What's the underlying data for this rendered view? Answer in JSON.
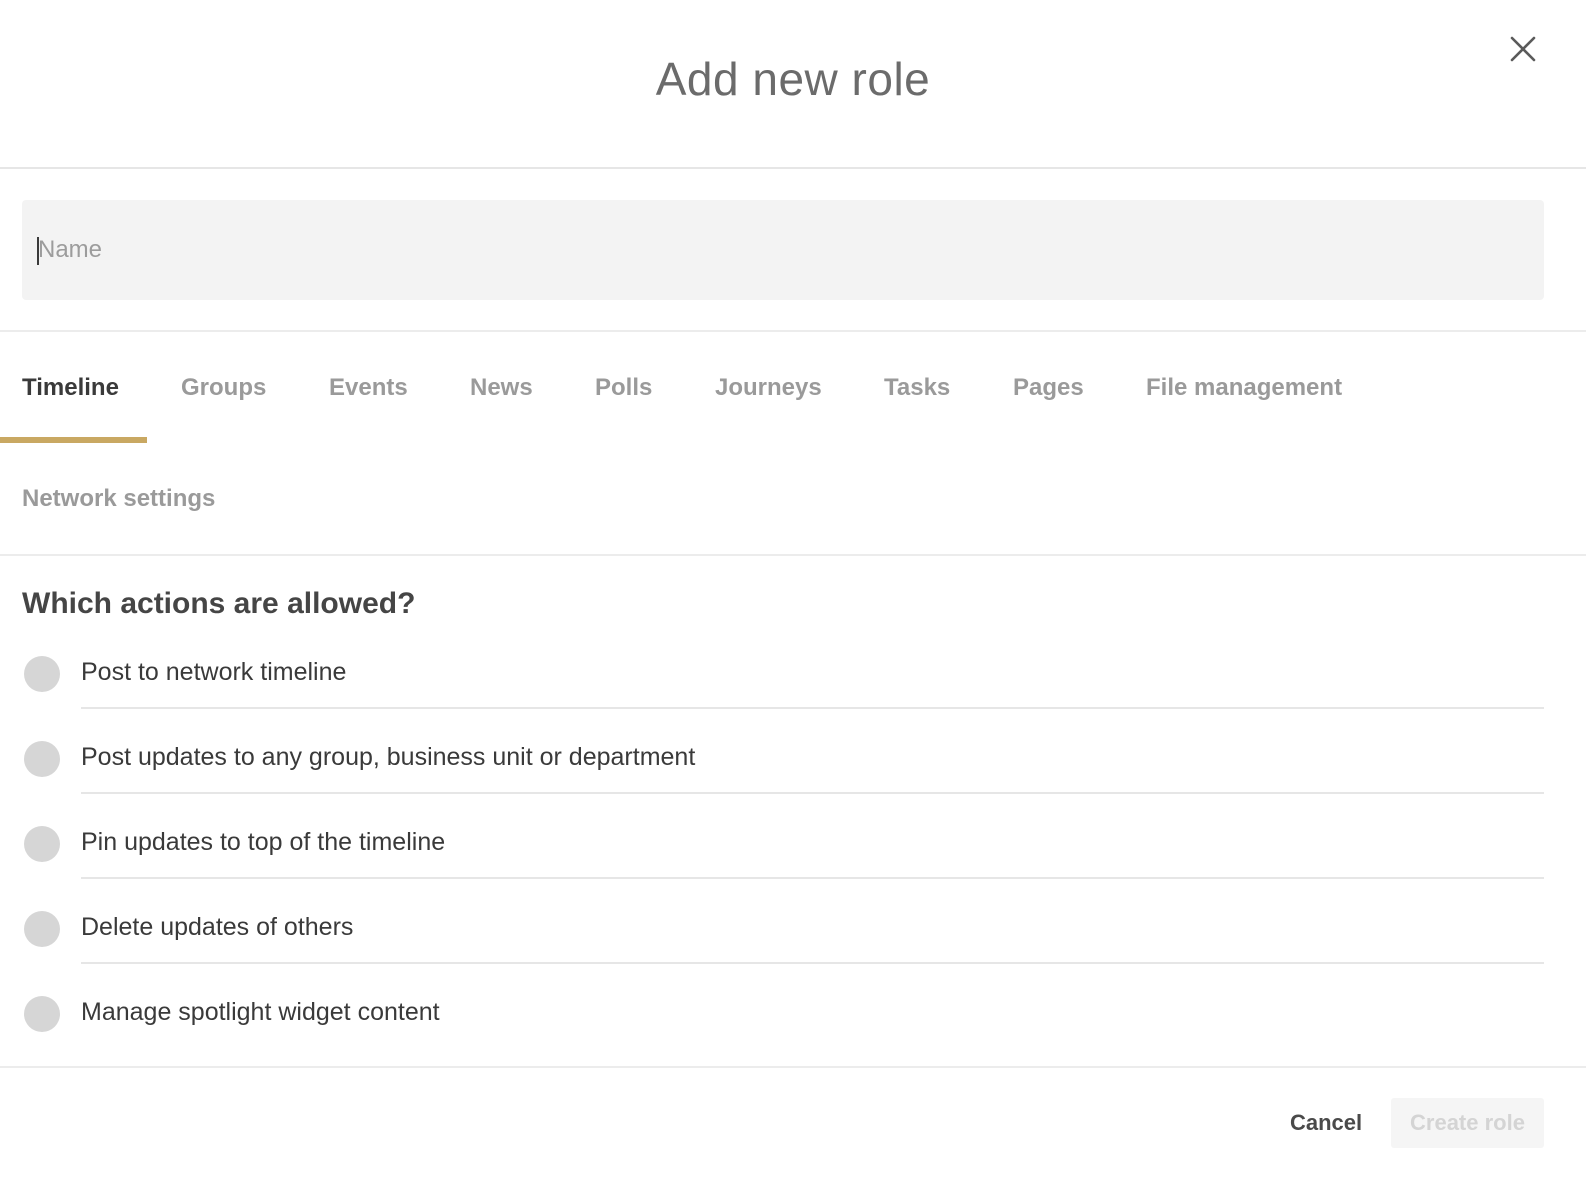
{
  "dialog": {
    "title": "Add new role",
    "close_icon": "close-icon"
  },
  "name_field": {
    "placeholder": "Name",
    "value": ""
  },
  "tabs": [
    {
      "label": "Timeline",
      "active": true
    },
    {
      "label": "Groups",
      "active": false
    },
    {
      "label": "Events",
      "active": false
    },
    {
      "label": "News",
      "active": false
    },
    {
      "label": "Polls",
      "active": false
    },
    {
      "label": "Journeys",
      "active": false
    },
    {
      "label": "Tasks",
      "active": false
    },
    {
      "label": "Pages",
      "active": false
    },
    {
      "label": "File management",
      "active": false
    },
    {
      "label": "Network settings",
      "active": false
    }
  ],
  "permissions": {
    "heading": "Which actions are allowed?",
    "items": [
      {
        "label": "Post to network timeline",
        "checked": false
      },
      {
        "label": "Post updates to any group, business unit or department",
        "checked": false
      },
      {
        "label": "Pin updates to top of the timeline",
        "checked": false
      },
      {
        "label": "Delete updates of others",
        "checked": false
      },
      {
        "label": "Manage spotlight widget content",
        "checked": false
      }
    ]
  },
  "footer": {
    "cancel_label": "Cancel",
    "create_label": "Create role",
    "create_enabled": false
  },
  "colors": {
    "accent": "#c9a862",
    "radio_off": "#d6d6d6",
    "input_bg": "#f3f3f3"
  }
}
